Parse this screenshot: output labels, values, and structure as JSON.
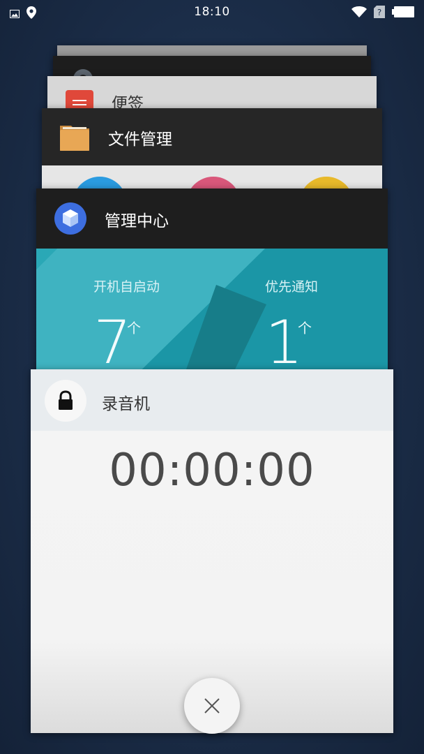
{
  "status_bar": {
    "time": "18:10",
    "left_icons": [
      "image-icon",
      "location-pin-icon"
    ],
    "right_icons": [
      "wifi-icon",
      "sim-unknown-icon",
      "battery-icon"
    ]
  },
  "recent_apps": {
    "cards": [
      {
        "label": "",
        "icon": "gray-card"
      },
      {
        "label": "",
        "icon": "gear-icon"
      },
      {
        "label": "便签",
        "icon": "memo-icon"
      },
      {
        "label": "文件管理",
        "icon": "folder-icon"
      },
      {
        "label": "管理中心",
        "icon": "security-cube-icon"
      },
      {
        "label": "录音机",
        "icon": "lock-icon"
      }
    ],
    "security_center": {
      "stats": [
        {
          "label": "开机自启动",
          "value": "7",
          "unit": "个"
        },
        {
          "label": "优先通知",
          "value": "1",
          "unit": "个"
        }
      ]
    },
    "recorder": {
      "timer": "00:00:00"
    }
  },
  "close_button": {
    "icon": "close-icon"
  },
  "colors": {
    "background": "#1b2d48",
    "security_teal": "#1fa0b0",
    "memo_red": "#e0483a",
    "folder_orange": "#e8a755",
    "security_blue": "#3d6ee0",
    "circle_blue": "#2a9be0",
    "circle_pink": "#d9577a",
    "circle_yellow": "#e8b92a"
  }
}
